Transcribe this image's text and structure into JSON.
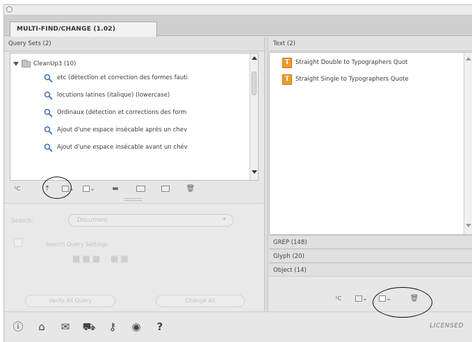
{
  "tab": {
    "label": "MULTI-FIND/CHANGE (1.02)"
  },
  "query_sets": {
    "header": "Query Sets (2)",
    "folder": "CleanUp3 (10)",
    "items": [
      "etc (détection et correction des formes fauti",
      "locutions latines (italique) (lowercase)",
      "Ordinaux (détection et corrections des form",
      "Ajout d'une espace insécable après un chev",
      "Ajout d'une espace insécable avant un chév"
    ]
  },
  "search": {
    "label": "Search:",
    "value": "Document"
  },
  "options": {
    "label": "Search Query Settings"
  },
  "buttons": {
    "left": "Verify All Query",
    "right": "Change All"
  },
  "text_sets": {
    "header": "Text (2)",
    "items": [
      "Straight Double to Typographers Quot",
      "Straight Single to Typographers Quote"
    ]
  },
  "sections": {
    "grep": "GREP (148)",
    "glyph": "Glyph (20)",
    "object": "Object (14)"
  },
  "toolbar": {
    "prefix_glyph": "ᴱC",
    "open_glyph": "⇡"
  },
  "bottom": {
    "licensed": "LICENSED",
    "help_glyph": "?"
  },
  "colors": {
    "query_icon": "#3d6fa8",
    "text_icon": "#ef9a2a"
  }
}
